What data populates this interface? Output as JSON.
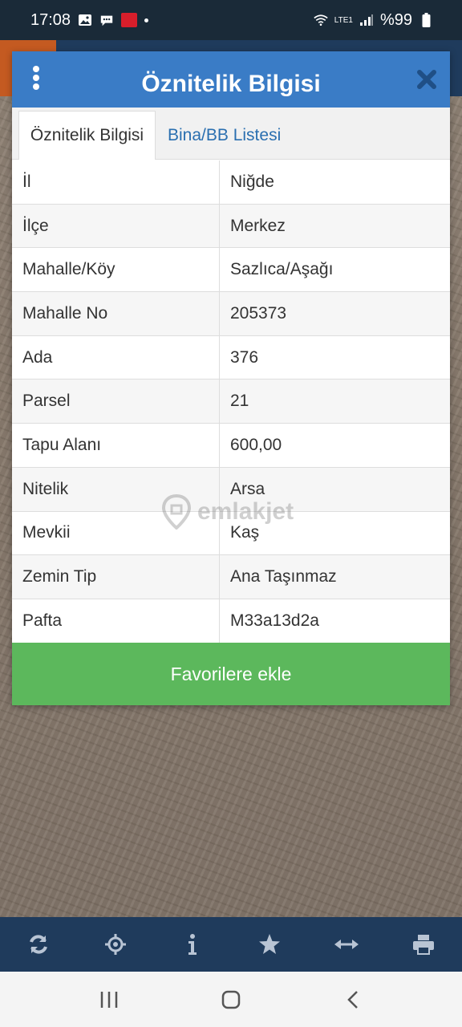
{
  "status_bar": {
    "time": "17:08",
    "battery": "%99",
    "network_label": "LTE1"
  },
  "dialog": {
    "title": "Öznitelik Bilgisi",
    "tabs": [
      {
        "label": "Öznitelik Bilgisi",
        "active": true
      },
      {
        "label": "Bina/BB Listesi",
        "active": false
      }
    ],
    "rows": [
      {
        "key": "İl",
        "value": "Niğde"
      },
      {
        "key": "İlçe",
        "value": "Merkez"
      },
      {
        "key": "Mahalle/Köy",
        "value": "Sazlıca/Aşağı"
      },
      {
        "key": "Mahalle No",
        "value": "205373"
      },
      {
        "key": "Ada",
        "value": "376"
      },
      {
        "key": "Parsel",
        "value": "21"
      },
      {
        "key": "Tapu Alanı",
        "value": "600,00"
      },
      {
        "key": "Nitelik",
        "value": "Arsa"
      },
      {
        "key": "Mevkii",
        "value": "Kaş"
      },
      {
        "key": "Zemin Tip",
        "value": "Ana Taşınmaz"
      },
      {
        "key": "Pafta",
        "value": "M33a13d2a"
      }
    ],
    "favorite_button": "Favorilere ekle"
  },
  "watermark": "emlakjet",
  "toolbar_icons": [
    "refresh-icon",
    "locate-icon",
    "info-icon",
    "star-icon",
    "measure-icon",
    "print-icon"
  ],
  "colors": {
    "header": "#3a7cc6",
    "favorite_button": "#5cb85c",
    "toolbar": "#1f3b5c"
  }
}
